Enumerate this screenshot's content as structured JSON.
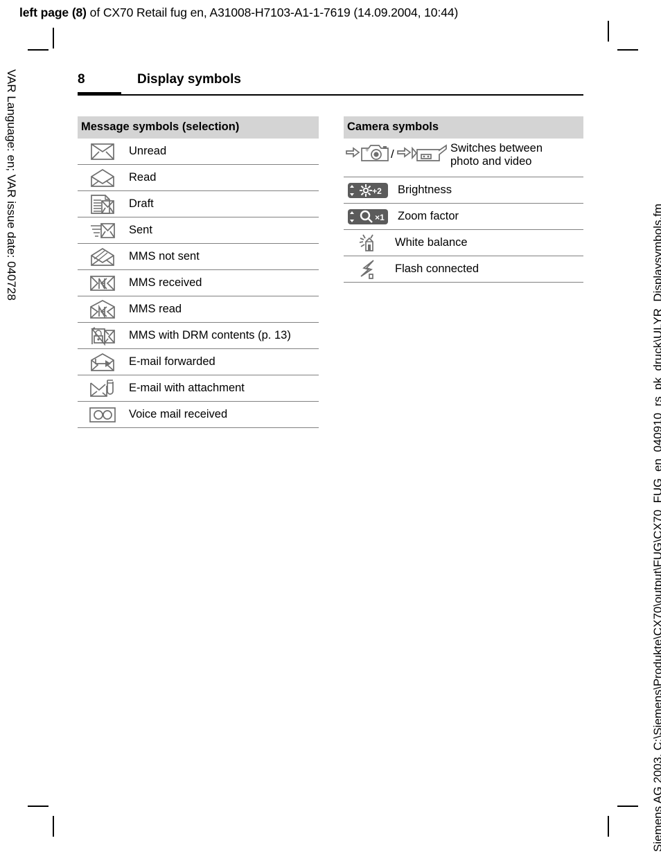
{
  "print_header": {
    "bold_prefix": "left page (8)",
    "rest": " of CX70 Retail fug en, A31008-H7103-A1-1-7619 (14.09.2004, 10:44)"
  },
  "side_captions": {
    "left": "VAR Language: en; VAR issue date: 040728",
    "right": "Siemens AG 2003, C:\\Siemens\\Produkte\\CX70\\output\\FUG\\CX70_FUG_en_040910_rs_pk_druck\\ULYR_Displaysymbols.fm"
  },
  "page_header": {
    "page_number": "8",
    "title": "Display symbols"
  },
  "tables": [
    {
      "id": "message-symbols",
      "header": "Message symbols (selection)",
      "rows": [
        {
          "icon": "envelope-closed-icon",
          "label": "Unread"
        },
        {
          "icon": "envelope-open-icon",
          "label": "Read"
        },
        {
          "icon": "envelope-draft-icon",
          "label": "Draft"
        },
        {
          "icon": "envelope-sent-icon",
          "label": "Sent"
        },
        {
          "icon": "envelope-mms-not-sent-icon",
          "label": "MMS not sent"
        },
        {
          "icon": "envelope-mms-received-icon",
          "label": "MMS received"
        },
        {
          "icon": "envelope-mms-read-icon",
          "label": "MMS read"
        },
        {
          "icon": "envelope-drm-lock-icon",
          "label": "MMS with DRM contents (p. 13)"
        },
        {
          "icon": "envelope-forwarded-icon",
          "label": "E-mail forwarded"
        },
        {
          "icon": "envelope-attachment-icon",
          "label": "E-mail with attachment"
        },
        {
          "icon": "voice-mail-icon",
          "label": "Voice mail received"
        }
      ]
    },
    {
      "id": "camera-symbols",
      "header": "Camera symbols",
      "rows": [
        {
          "icon": "photo-video-toggle-icon",
          "label": "Switches between photo and video",
          "label_line1": "Switches between",
          "label_line2": "photo and video"
        },
        {
          "icon": "brightness-icon",
          "label": "Brightness",
          "badge_value": "+2"
        },
        {
          "icon": "zoom-factor-icon",
          "label": "Zoom factor",
          "badge_value": "×1"
        },
        {
          "icon": "white-balance-icon",
          "label": "White balance"
        },
        {
          "icon": "flash-connected-icon",
          "label": "Flash connected"
        }
      ]
    }
  ],
  "colors": {
    "header_band": "#d4d4d4",
    "rule": "#808080",
    "icon_gray": "#6f6f6f",
    "icon_dark": "#5b5b5b",
    "text": "#000000"
  }
}
